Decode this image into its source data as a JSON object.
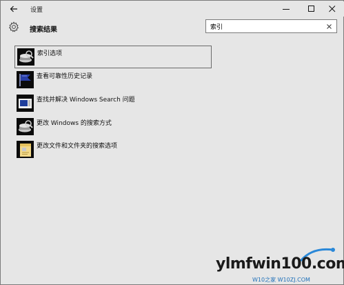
{
  "window": {
    "title": "设置",
    "controls": {
      "minimize_icon": "minimize-icon",
      "maximize_icon": "maximize-icon",
      "close_icon": "close-icon"
    }
  },
  "header": {
    "title": "搜索结果",
    "icon": "gear-icon"
  },
  "search": {
    "value": "索引",
    "clear_icon": "close-icon"
  },
  "results": [
    {
      "label": "索引选项",
      "icon": "indexing-icon",
      "selected": true
    },
    {
      "label": "查看可靠性历史记录",
      "icon": "flag-icon",
      "selected": false
    },
    {
      "label": "查找并解决 Windows Search 问题",
      "icon": "troubleshoot-icon",
      "selected": false
    },
    {
      "label": "更改 Windows 的搜索方式",
      "icon": "indexing-icon",
      "selected": false
    },
    {
      "label": "更改文件和文件夹的搜索选项",
      "icon": "folder-options-icon",
      "selected": false
    }
  ],
  "watermark": {
    "text": "ylmfwin100.com",
    "sub": "W10之家 W10ZJ.COM"
  },
  "colors": {
    "background": "#e6e6e6",
    "selection_border": "#6a6a6a",
    "search_border": "#7a7a7a"
  }
}
